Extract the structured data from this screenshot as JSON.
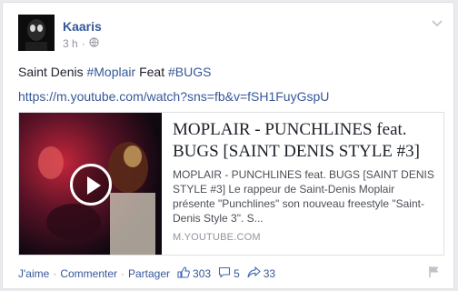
{
  "post": {
    "author": "Kaaris",
    "time": "3 h",
    "text_plain": "Saint Denis ",
    "hashtag1": "#Moplair",
    "text_mid": " Feat ",
    "hashtag2": "#BUGS",
    "link": "https://m.youtube.com/watch?sns=fb&v=fSH1FuyGspU"
  },
  "preview": {
    "title": "MOPLAIR - PUNCHLINES feat. BUGS [SAINT DENIS STYLE #3]",
    "description": "MOPLAIR - PUNCHLINES feat. BUGS [SAINT DENIS STYLE #3] Le rappeur de Saint-Denis Moplair présente \"Punchlines\" son nouveau freestyle \"Saint-Denis Style 3\". S...",
    "domain": "M.YOUTUBE.COM"
  },
  "actions": {
    "like": "J'aime",
    "sep": "·",
    "comment": "Commenter",
    "share": "Partager",
    "likes_count": "303",
    "comments_count": "5",
    "shares_count": "33"
  },
  "icons": {
    "menu": "chevron-down-icon",
    "privacy": "globe-icon",
    "play": "play-icon",
    "like": "thumbs-up-icon",
    "comment": "comment-icon",
    "share": "share-icon",
    "flag": "flag-icon"
  }
}
